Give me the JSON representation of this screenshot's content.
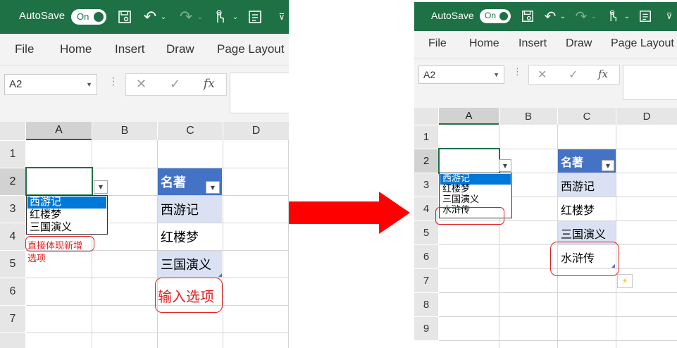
{
  "titlebar": {
    "autosave_label": "AutoSave",
    "toggle_label": "On",
    "colors": {
      "titlebar": "#1e7145",
      "table_header": "#4472c4",
      "table_band": "#d9e1f2",
      "annotation": "#e02020",
      "arrow": "#ff0000"
    }
  },
  "menu": {
    "items": [
      "File",
      "Home",
      "Insert",
      "Draw",
      "Page Layout"
    ]
  },
  "formula_bar": {
    "name_box": "A2",
    "cancel_icon": "✕",
    "enter_icon": "✓",
    "fx_label": "fx"
  },
  "columns": [
    "A",
    "B",
    "C",
    "D"
  ],
  "left": {
    "rows": [
      "1",
      "2",
      "3",
      "4",
      "5",
      "6",
      "7"
    ],
    "dropdown_options": [
      "西游记",
      "红楼梦",
      "三国演义"
    ],
    "table": {
      "header": "名著",
      "values": [
        "西游记",
        "红楼梦",
        "三国演义"
      ]
    },
    "note_line1": "直接体现新增",
    "note_line2": "选项",
    "callout": "输入选项"
  },
  "right": {
    "rows": [
      "1",
      "2",
      "3",
      "4",
      "5",
      "6",
      "7",
      "8",
      "9"
    ],
    "dropdown_options": [
      "西游记",
      "红楼梦",
      "三国演义",
      "水浒传"
    ],
    "table": {
      "header": "名著",
      "values": [
        "西游记",
        "红楼梦",
        "三国演义",
        "水浒传"
      ]
    }
  }
}
